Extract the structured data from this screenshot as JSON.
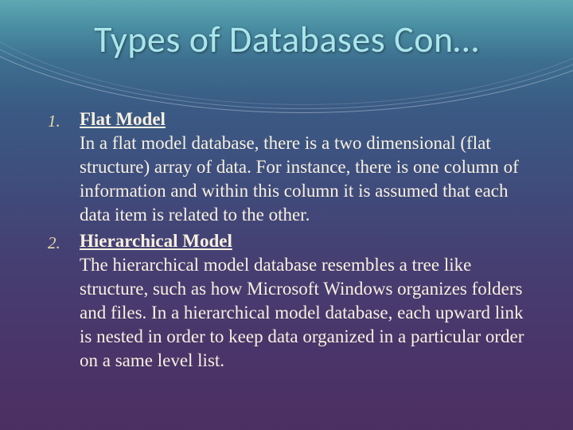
{
  "title": "Types of Databases Con…",
  "items": [
    {
      "num": "1.",
      "heading": "Flat Model",
      "text": "In a flat model database, there is a two dimensional (flat structure) array of data. For instance, there is one column of information and within this column it is assumed that each data item is related to the other."
    },
    {
      "num": "2.",
      "heading": "Hierarchical Model",
      "text": "The hierarchical model database resembles a tree like structure, such as how Microsoft Windows organizes folders and files. In a hierarchical model database, each upward link is nested in order to keep data organized in a particular order on a same level list."
    }
  ]
}
